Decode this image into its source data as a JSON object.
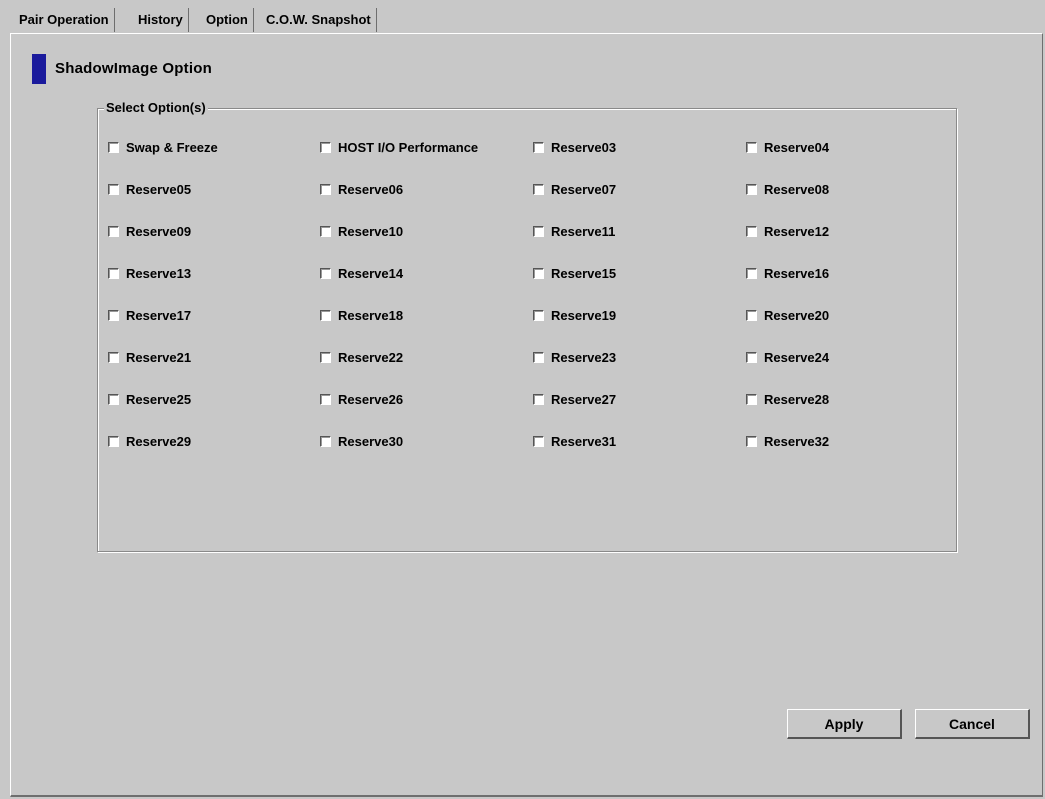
{
  "tabs": [
    {
      "label": "Pair Operation",
      "active": false
    },
    {
      "label": "History",
      "active": false
    },
    {
      "label": "Option",
      "active": true
    },
    {
      "label": "C.O.W. Snapshot",
      "active": false
    }
  ],
  "section": {
    "title": "ShadowImage Option"
  },
  "options_group": {
    "title": "Select Option(s)",
    "options": [
      {
        "label": "Swap & Freeze",
        "checked": false
      },
      {
        "label": "HOST I/O Performance",
        "checked": false
      },
      {
        "label": "Reserve03",
        "checked": false
      },
      {
        "label": "Reserve04",
        "checked": false
      },
      {
        "label": "Reserve05",
        "checked": false
      },
      {
        "label": "Reserve06",
        "checked": false
      },
      {
        "label": "Reserve07",
        "checked": false
      },
      {
        "label": "Reserve08",
        "checked": false
      },
      {
        "label": "Reserve09",
        "checked": false
      },
      {
        "label": "Reserve10",
        "checked": false
      },
      {
        "label": "Reserve11",
        "checked": false
      },
      {
        "label": "Reserve12",
        "checked": false
      },
      {
        "label": "Reserve13",
        "checked": false
      },
      {
        "label": "Reserve14",
        "checked": false
      },
      {
        "label": "Reserve15",
        "checked": false
      },
      {
        "label": "Reserve16",
        "checked": false
      },
      {
        "label": "Reserve17",
        "checked": false
      },
      {
        "label": "Reserve18",
        "checked": false
      },
      {
        "label": "Reserve19",
        "checked": false
      },
      {
        "label": "Reserve20",
        "checked": false
      },
      {
        "label": "Reserve21",
        "checked": false
      },
      {
        "label": "Reserve22",
        "checked": false
      },
      {
        "label": "Reserve23",
        "checked": false
      },
      {
        "label": "Reserve24",
        "checked": false
      },
      {
        "label": "Reserve25",
        "checked": false
      },
      {
        "label": "Reserve26",
        "checked": false
      },
      {
        "label": "Reserve27",
        "checked": false
      },
      {
        "label": "Reserve28",
        "checked": false
      },
      {
        "label": "Reserve29",
        "checked": false
      },
      {
        "label": "Reserve30",
        "checked": false
      },
      {
        "label": "Reserve31",
        "checked": false
      },
      {
        "label": "Reserve32",
        "checked": false
      }
    ]
  },
  "buttons": {
    "apply": "Apply",
    "cancel": "Cancel"
  },
  "colors": {
    "background": "#c8c8c8",
    "heading_marker": "#1a1a9c"
  }
}
